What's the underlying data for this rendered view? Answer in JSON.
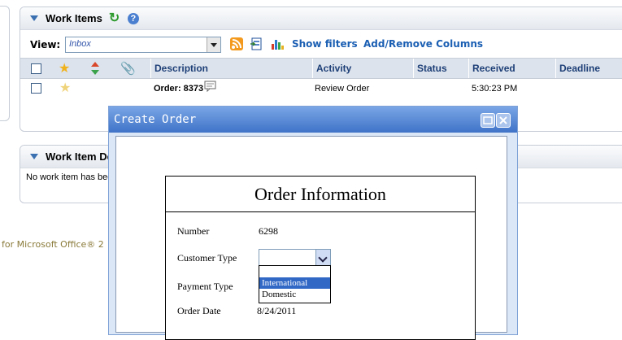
{
  "work_items": {
    "title": "Work Items",
    "view_label": "View:",
    "view_value": "Inbox",
    "show_filters": "Show filters",
    "add_remove_columns": "Add/Remove Columns",
    "columns": [
      "Description",
      "Activity",
      "Status",
      "Received",
      "Deadline"
    ],
    "rows": [
      {
        "description": "Order: 8373",
        "activity": "Review Order",
        "status": "",
        "received": "5:30:23 PM",
        "deadline": ""
      }
    ]
  },
  "details": {
    "title": "Work Item Det",
    "message": "No work item has bee"
  },
  "footer_text": "for Microsoft Office® 2",
  "dialog": {
    "title": "Create Order",
    "form_title": "Order Information",
    "number_label": "Number",
    "number_value": "6298",
    "customer_type_label": "Customer Type",
    "customer_type_value": "",
    "customer_type_options": [
      "",
      "International",
      "Domestic"
    ],
    "payment_type_label": "Payment Type",
    "order_date_label": "Order Date",
    "order_date_value": "8/24/2011"
  },
  "colors": {
    "accent_blue": "#3f73c8",
    "selected_option": "#3168c6",
    "link": "#1b5fb3"
  }
}
